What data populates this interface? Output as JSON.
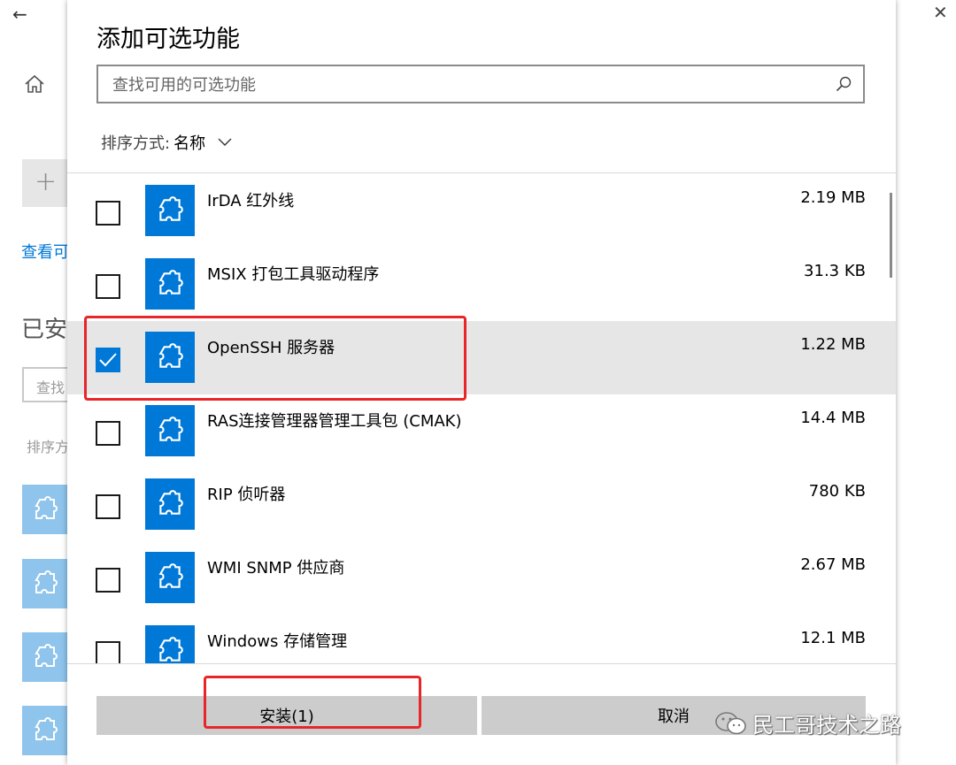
{
  "dialog": {
    "title": "添加可选功能",
    "search_placeholder": "查找可用的可选功能",
    "sort_label": "排序方式:",
    "sort_value": "名称",
    "features": [
      {
        "name": "IrDA 红外线",
        "size": "2.19 MB",
        "checked": false
      },
      {
        "name": "MSIX 打包工具驱动程序",
        "size": "31.3 KB",
        "checked": false
      },
      {
        "name": "OpenSSH 服务器",
        "size": "1.22 MB",
        "checked": true
      },
      {
        "name": "RAS连接管理器管理工具包 (CMAK)",
        "size": "14.4 MB",
        "checked": false
      },
      {
        "name": "RIP 侦听器",
        "size": "780 KB",
        "checked": false
      },
      {
        "name": "WMI SNMP 供应商",
        "size": "2.67 MB",
        "checked": false
      },
      {
        "name": "Windows 存储管理",
        "size": "12.1 MB",
        "checked": false
      }
    ],
    "install_label": "安装(1)",
    "cancel_label": "取消"
  },
  "background": {
    "view_link": "查看可",
    "installed_heading": "已安",
    "search_placeholder": "查找",
    "sort_label": "排序方"
  },
  "window_controls": {
    "minimize": "—",
    "maximize": "☐",
    "close": "✕",
    "back": "←"
  },
  "watermark": "民工哥技术之路",
  "colors": {
    "accent": "#0078d7",
    "selected_row": "#e6e6e6",
    "button_bg": "#cccccc",
    "annotation": "#e8262a",
    "bg_tile": "#8fc4ec"
  }
}
